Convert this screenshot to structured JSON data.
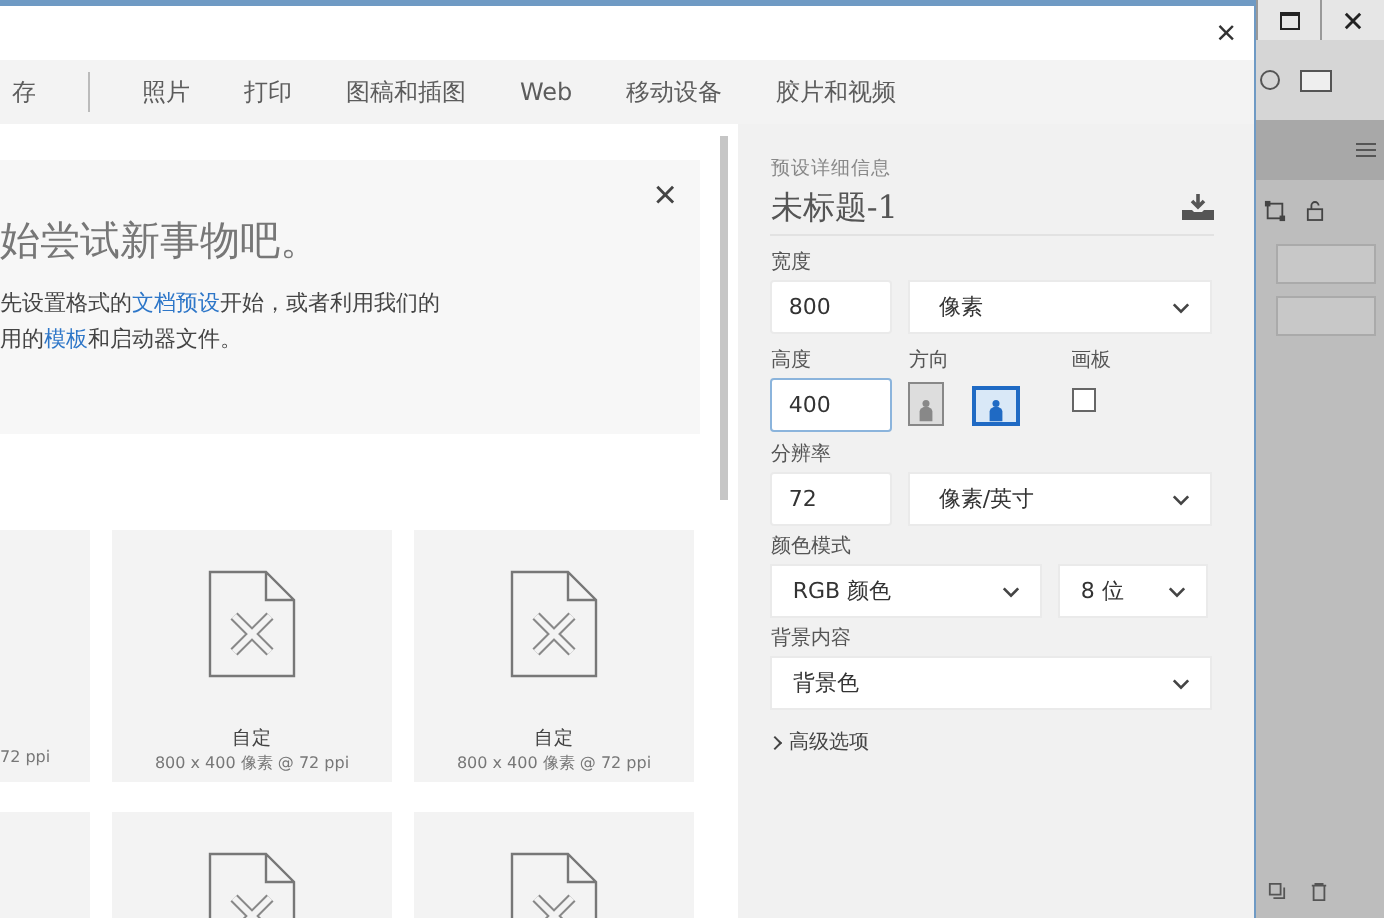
{
  "dialog": {
    "close": "×"
  },
  "tabs": [
    {
      "label": "存",
      "selected": false
    },
    {
      "label": "照片",
      "selected": false
    },
    {
      "label": "打印",
      "selected": false
    },
    {
      "label": "图稿和插图",
      "selected": false
    },
    {
      "label": "Web",
      "selected": false
    },
    {
      "label": "移动设备",
      "selected": false
    },
    {
      "label": "胶片和视频",
      "selected": false
    }
  ],
  "banner": {
    "close": "×",
    "heading": "始尝试新事物吧。",
    "line_1": {
      "before": "先设置格式的",
      "link": "文档预设",
      "after": "开始，或者利用我们的"
    },
    "line_2": {
      "before": "用的",
      "link": "模板",
      "after": "和启动器文件。"
    }
  },
  "presets": [
    {
      "kind": "clipped",
      "subtitle": "72 ppi"
    },
    {
      "kind": "document",
      "title": "自定",
      "subtitle": "800 x 400 像素 @ 72 ppi"
    },
    {
      "kind": "document",
      "title": "自定",
      "subtitle": "800 x 400 像素 @ 72 ppi"
    },
    {
      "kind": "clipped"
    },
    {
      "kind": "document"
    },
    {
      "kind": "document"
    }
  ],
  "details": {
    "heading": "预设详细信息",
    "name": "未标题-1",
    "width": {
      "label": "宽度",
      "value": "800",
      "unit": "像素",
      "focused": false
    },
    "height": {
      "label": "高度",
      "value": "400",
      "focused": true
    },
    "orientation": {
      "label": "方向",
      "options": [
        {
          "kind": "portrait",
          "selected": false
        },
        {
          "kind": "landscape",
          "selected": true
        }
      ]
    },
    "artboard": {
      "label": "画板",
      "checked": false
    },
    "resolution": {
      "label": "分辨率",
      "value": "72",
      "unit": "像素/英寸",
      "focused": false
    },
    "color_mode": {
      "label": "颜色模式",
      "mode": "RGB 颜色",
      "depth": "8 位"
    },
    "background": {
      "label": "背景内容",
      "value": "背景色"
    },
    "advanced": {
      "label": "高级选项",
      "expanded": false
    }
  }
}
